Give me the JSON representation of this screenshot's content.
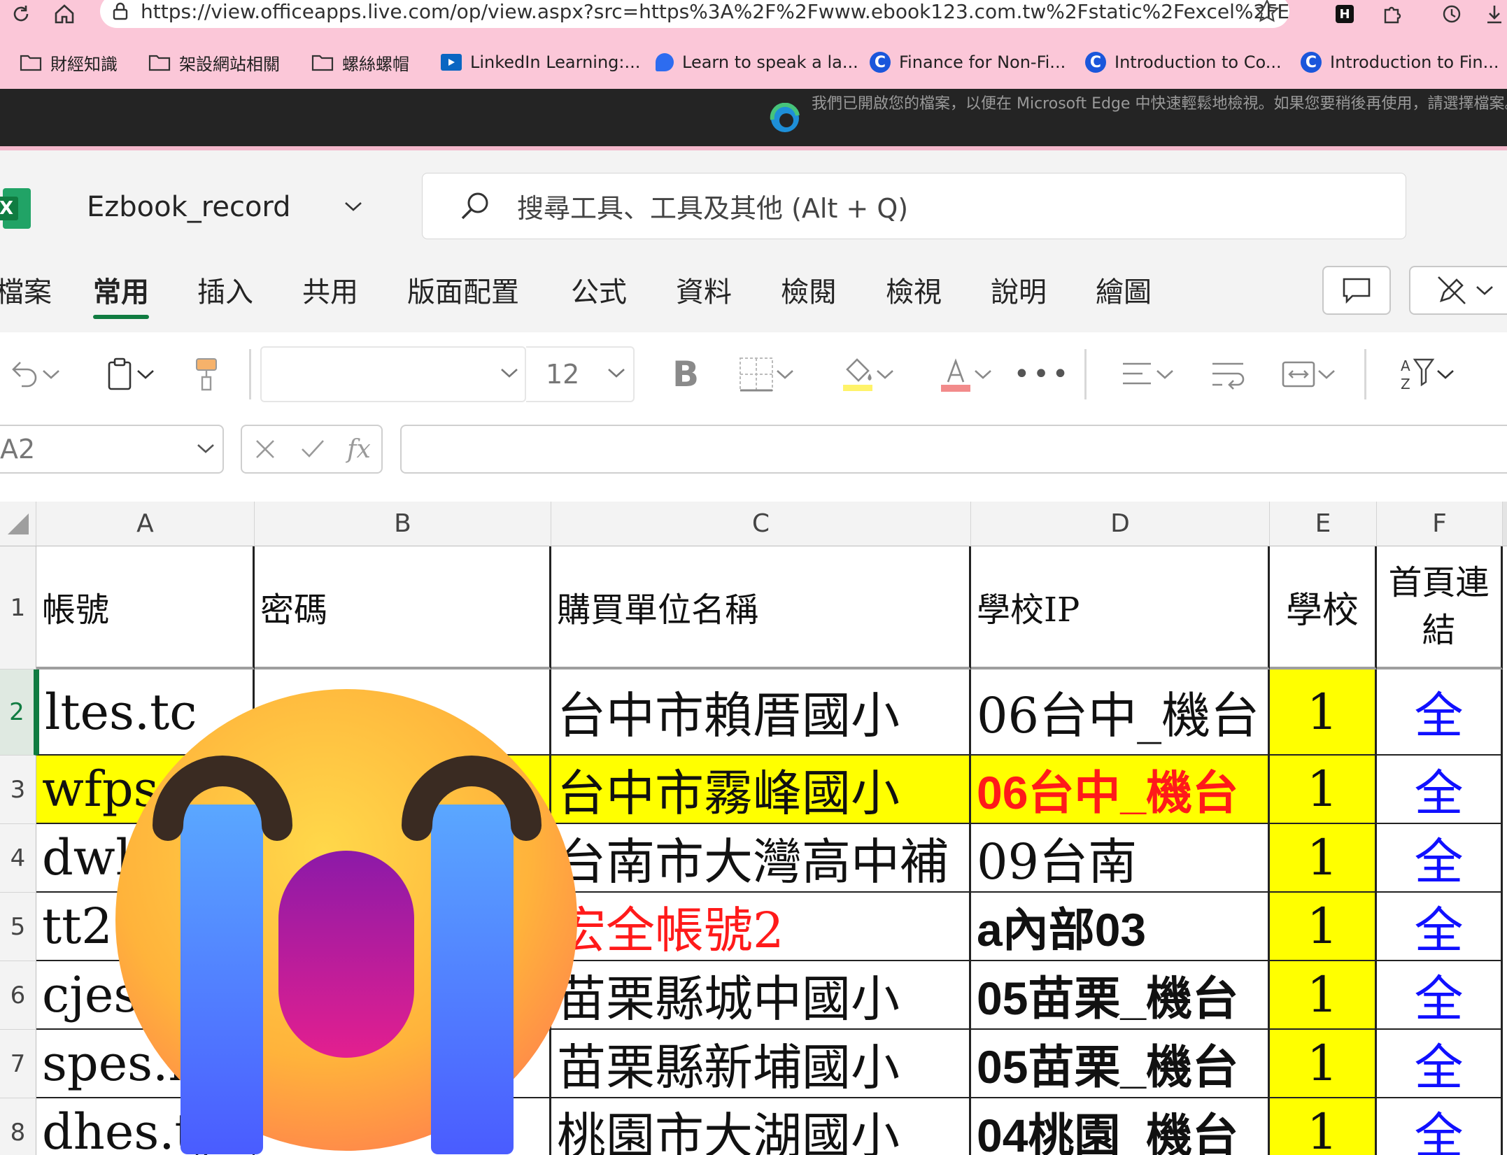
{
  "browser": {
    "url": "https://view.officeapps.live.com/op/view.aspx?src=https%3A%2F%2Fwww.ebook123.com.tw%2Fstatic%2Fexcel%2FEzbook_recor...",
    "bookmarks": [
      {
        "label": "財經知識",
        "icon": "folder-icon"
      },
      {
        "label": "架設網站相關",
        "icon": "folder-icon"
      },
      {
        "label": "螺絲螺帽",
        "icon": "folder-icon"
      },
      {
        "label": "LinkedIn Learning:...",
        "icon": "linkedin-learning-icon"
      },
      {
        "label": "Learn to speak a la...",
        "icon": "speech-app-icon"
      },
      {
        "label": "Finance for Non-Fi...",
        "icon": "coursera-icon"
      },
      {
        "label": "Introduction to Co...",
        "icon": "coursera-icon"
      },
      {
        "label": "Introduction to Fin...",
        "icon": "coursera-icon"
      }
    ],
    "edge_message": "我們已開啟您的檔案，以便在 Microsoft Edge 中快速輕鬆地檢視。如果您要稍後再使用，請選擇檔案。"
  },
  "excel": {
    "doc_title": "Ezbook_record",
    "search_placeholder": "搜尋工具、工具及其他 (Alt + Q)",
    "menu_tabs": [
      "檔案",
      "常用",
      "插入",
      "共用",
      "版面配置",
      "公式",
      "資料",
      "檢閱",
      "檢視",
      "說明",
      "繪圖"
    ],
    "active_tab": "常用",
    "font_size": "12",
    "name_box": "A2",
    "fx_label": "fx"
  },
  "sheet": {
    "columns": [
      "A",
      "B",
      "C",
      "D",
      "E",
      "F"
    ],
    "row_numbers": [
      "1",
      "2",
      "3",
      "4",
      "5",
      "6",
      "7",
      "8"
    ],
    "header_row": [
      "帳號",
      "密碼",
      "購買單位名稱",
      "學校IP",
      "學校",
      "首頁連結"
    ],
    "rows": [
      [
        "ltes.tc",
        "",
        "台中市賴厝國小",
        "06台中_機台",
        "1",
        "全"
      ],
      [
        "wfps",
        "",
        "台中市霧峰國小",
        "06台中_機台",
        "1",
        "全"
      ],
      [
        "dwh",
        "",
        "台南市大灣高中補",
        "09台南",
        "1",
        "全"
      ],
      [
        "tt2.2",
        "",
        "宏全帳號2",
        "a內部03",
        "1",
        "全"
      ],
      [
        "cjes.",
        "",
        "苗栗縣城中國小",
        "05苗栗_機台",
        "1",
        "全"
      ],
      [
        "spes.m",
        "",
        "苗栗縣新埔國小",
        "05苗栗_機台",
        "1",
        "全"
      ],
      [
        "dhes.tyc",
        "",
        "桃園市大湖國小",
        "04桃園_機台",
        "1",
        "全"
      ]
    ],
    "colors": {
      "highlight_yellow": "#ffff00",
      "link_blue": "#1010ff",
      "alert_red": "#ff1a1a",
      "excel_green": "#107c41"
    }
  },
  "overlay": {
    "icon": "loudly-crying-face-emoji"
  }
}
